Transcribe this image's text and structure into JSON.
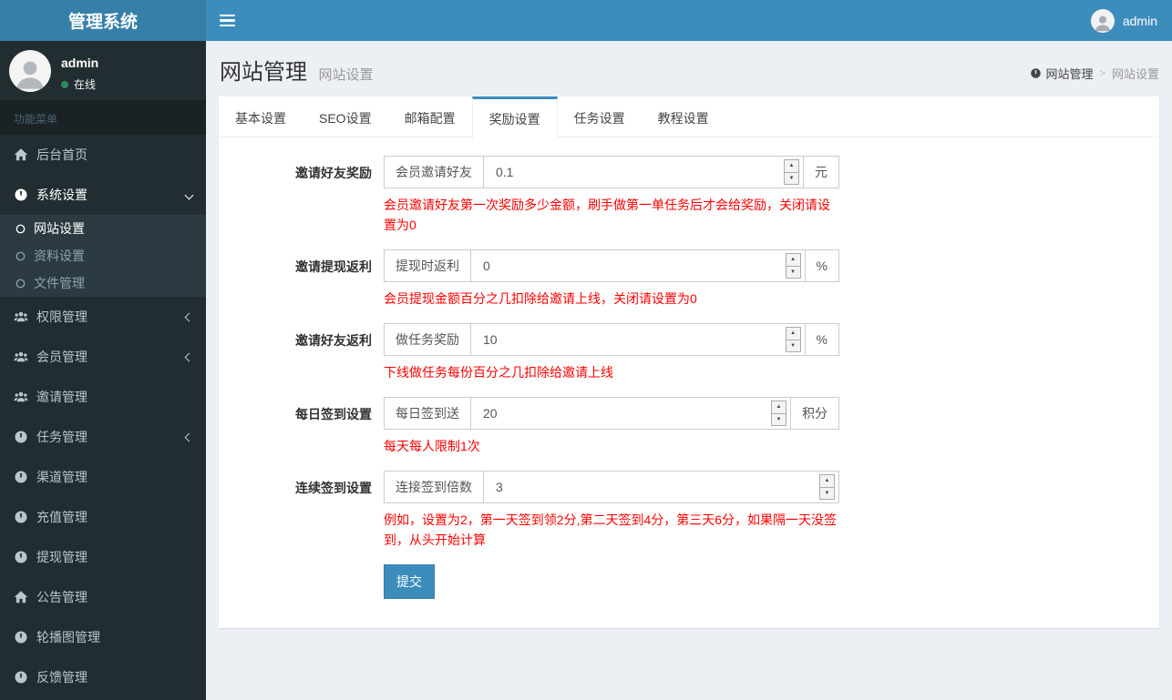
{
  "app": {
    "title": "管理系统"
  },
  "navbar": {
    "user_name": "admin"
  },
  "sidebar": {
    "user": {
      "name": "admin",
      "status": "在线"
    },
    "section_label": "功能菜单",
    "items": [
      {
        "label": "后台首页",
        "icon": "home-icon"
      },
      {
        "label": "系统设置",
        "icon": "gauge-icon",
        "expanded": true,
        "children": [
          {
            "label": "网站设置",
            "icon": "circle-o-icon",
            "active": true
          },
          {
            "label": "资料设置",
            "icon": "circle-o-icon"
          },
          {
            "label": "文件管理",
            "icon": "circle-o-icon"
          }
        ]
      },
      {
        "label": "权限管理",
        "icon": "users-icon",
        "collapsed": true
      },
      {
        "label": "会员管理",
        "icon": "users-icon",
        "collapsed": true
      },
      {
        "label": "邀请管理",
        "icon": "users-icon"
      },
      {
        "label": "任务管理",
        "icon": "gauge-icon",
        "collapsed": true
      },
      {
        "label": "渠道管理",
        "icon": "gauge-icon"
      },
      {
        "label": "充值管理",
        "icon": "gauge-icon"
      },
      {
        "label": "提现管理",
        "icon": "gauge-icon"
      },
      {
        "label": "公告管理",
        "icon": "home-icon"
      },
      {
        "label": "轮播图管理",
        "icon": "gauge-icon"
      },
      {
        "label": "反馈管理",
        "icon": "gauge-icon"
      }
    ]
  },
  "content_header": {
    "title": "网站管理",
    "subtitle": "网站设置",
    "breadcrumb": {
      "icon": "gauge-icon",
      "root": "网站管理",
      "separator": ">",
      "current": "网站设置"
    }
  },
  "tabs": [
    {
      "label": "基本设置"
    },
    {
      "label": "SEO设置"
    },
    {
      "label": "邮箱配置"
    },
    {
      "label": "奖励设置",
      "active": true
    },
    {
      "label": "任务设置"
    },
    {
      "label": "教程设置"
    }
  ],
  "form": {
    "rows": [
      {
        "label": "邀请好友奖励",
        "addon": "会员邀请好友",
        "value": "0.1",
        "unit": "元",
        "help": "会员邀请好友第一次奖励多少金额，刷手做第一单任务后才会给奖励，关闭请设置为0"
      },
      {
        "label": "邀请提现返利",
        "addon": "提现时返利",
        "value": "0",
        "unit": "%",
        "help": "会员提现金额百分之几扣除给邀请上线，关闭请设置为0"
      },
      {
        "label": "邀请好友返利",
        "addon": "做任务奖励",
        "value": "10",
        "unit": "%",
        "help": "下线做任务每份百分之几扣除给邀请上线"
      },
      {
        "label": "每日签到设置",
        "addon": "每日签到送",
        "value": "20",
        "unit": "积分",
        "help": "每天每人限制1次"
      },
      {
        "label": "连续签到设置",
        "addon": "连接签到倍数",
        "value": "3",
        "unit": "",
        "help": "例如，设置为2，第一天签到领2分,第二天签到4分，第三天6分，如果隔一天没签到，从头开始计算"
      }
    ],
    "submit_label": "提交"
  },
  "colors": {
    "accent": "#3c8dbc",
    "logo_bg": "#367fa9",
    "sidebar_bg": "#222d32",
    "submenu_bg": "#2c3b41",
    "content_bg": "#ecf0f5",
    "help_text": "#ff0000",
    "online_dot": "#2e8b57"
  }
}
